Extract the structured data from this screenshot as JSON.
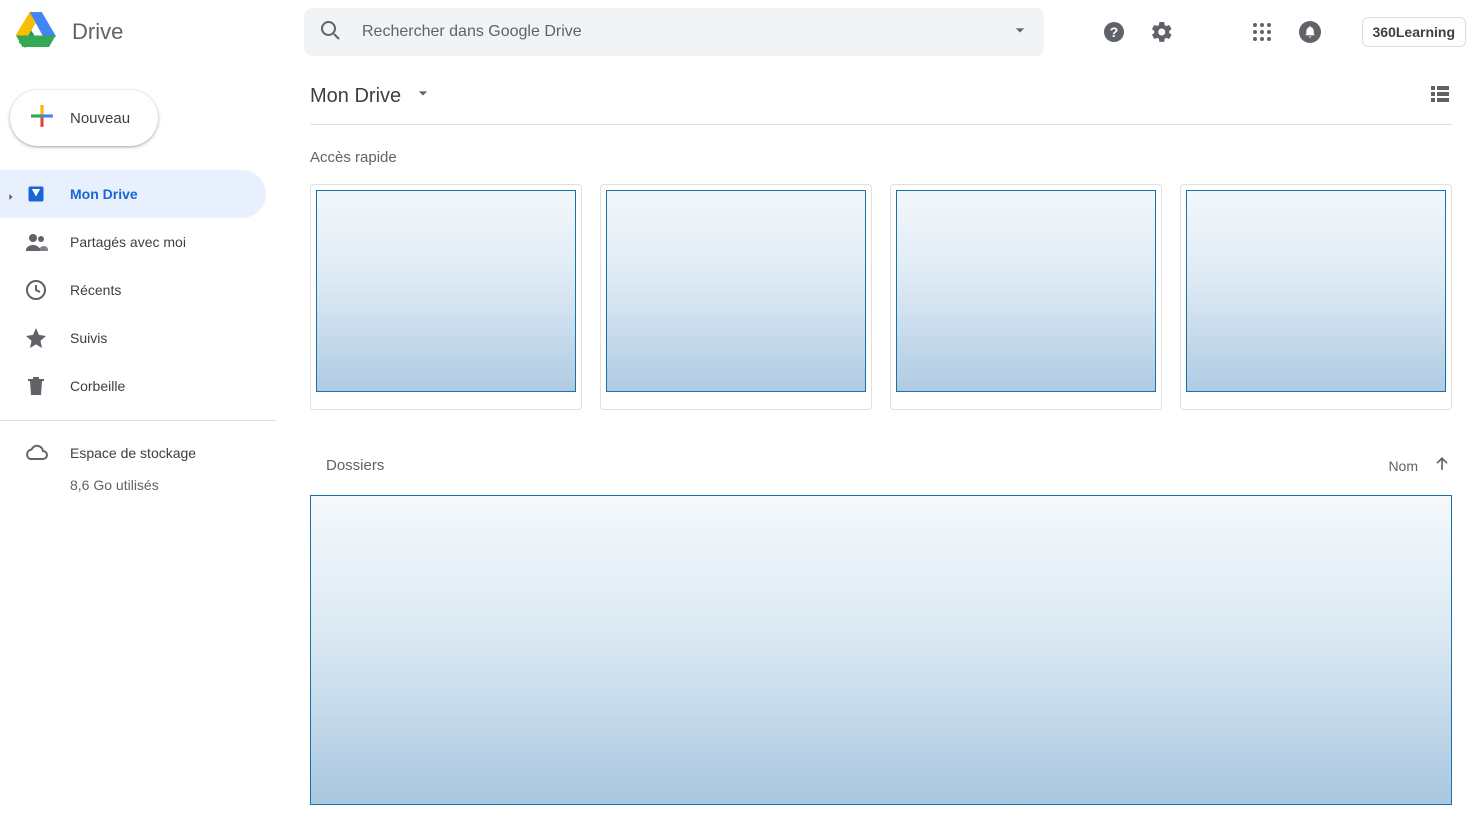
{
  "app": {
    "name": "Drive"
  },
  "search": {
    "placeholder": "Rechercher dans Google Drive"
  },
  "header": {
    "account_label": "360Learning"
  },
  "new_button": {
    "label": "Nouveau"
  },
  "sidebar": {
    "items": [
      {
        "label": "Mon Drive"
      },
      {
        "label": "Partagés avec moi"
      },
      {
        "label": "Récents"
      },
      {
        "label": "Suivis"
      },
      {
        "label": "Corbeille"
      }
    ],
    "storage": {
      "label": "Espace de stockage",
      "used": "8,6 Go utilisés"
    }
  },
  "breadcrumb": {
    "title": "Mon Drive"
  },
  "sections": {
    "quick_access": "Accès rapide",
    "folders": "Dossiers"
  },
  "sort": {
    "label": "Nom"
  }
}
